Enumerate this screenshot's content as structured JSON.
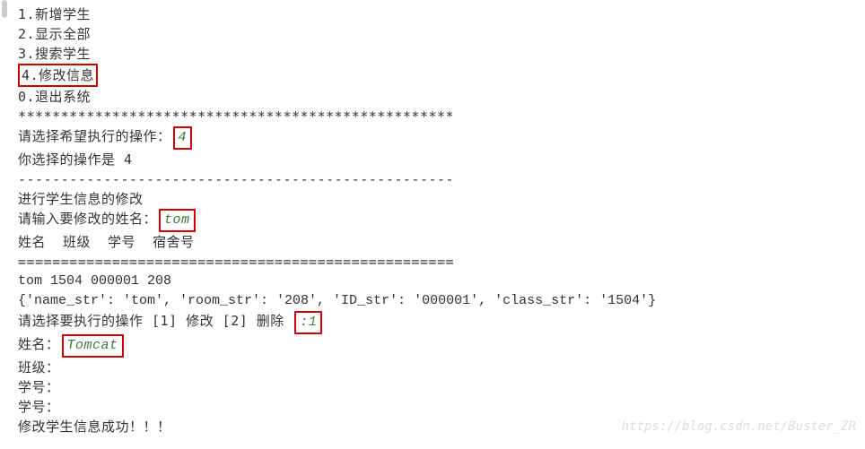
{
  "menu": {
    "item1": "1.新增学生",
    "item2": "2.显示全部",
    "item3": "3.搜索学生",
    "item4": "4.修改信息",
    "item0": "0.退出系统"
  },
  "divider_stars": "***************************************************",
  "prompt_select": "请选择希望执行的操作：",
  "input_choice": "4",
  "echo_choice": "你选择的操作是 4",
  "divider_dash": "---------------------------------------------------",
  "modify_title": "进行学生信息的修改",
  "prompt_name": "请输入要修改的姓名：",
  "input_name": "tom",
  "headers": "姓名  班级  学号  宿舍号",
  "divider_eq": "===================================================",
  "record_line": "tom 1504 000001 208",
  "dict_line": "{'name_str': 'tom', 'room_str': '208', 'ID_str': '000001', 'class_str': '1504'}",
  "prompt_action_pre": "请选择要执行的操作 [1] 修改 [2] 删除 ",
  "input_action": ":1",
  "label_name": "姓名：",
  "input_newname": "Tomcat",
  "label_class": "班级：",
  "label_id1": "学号：",
  "label_id2": "学号：",
  "success_msg": "修改学生信息成功！！！",
  "watermark": "https://blog.csdn.net/Buster_ZR"
}
